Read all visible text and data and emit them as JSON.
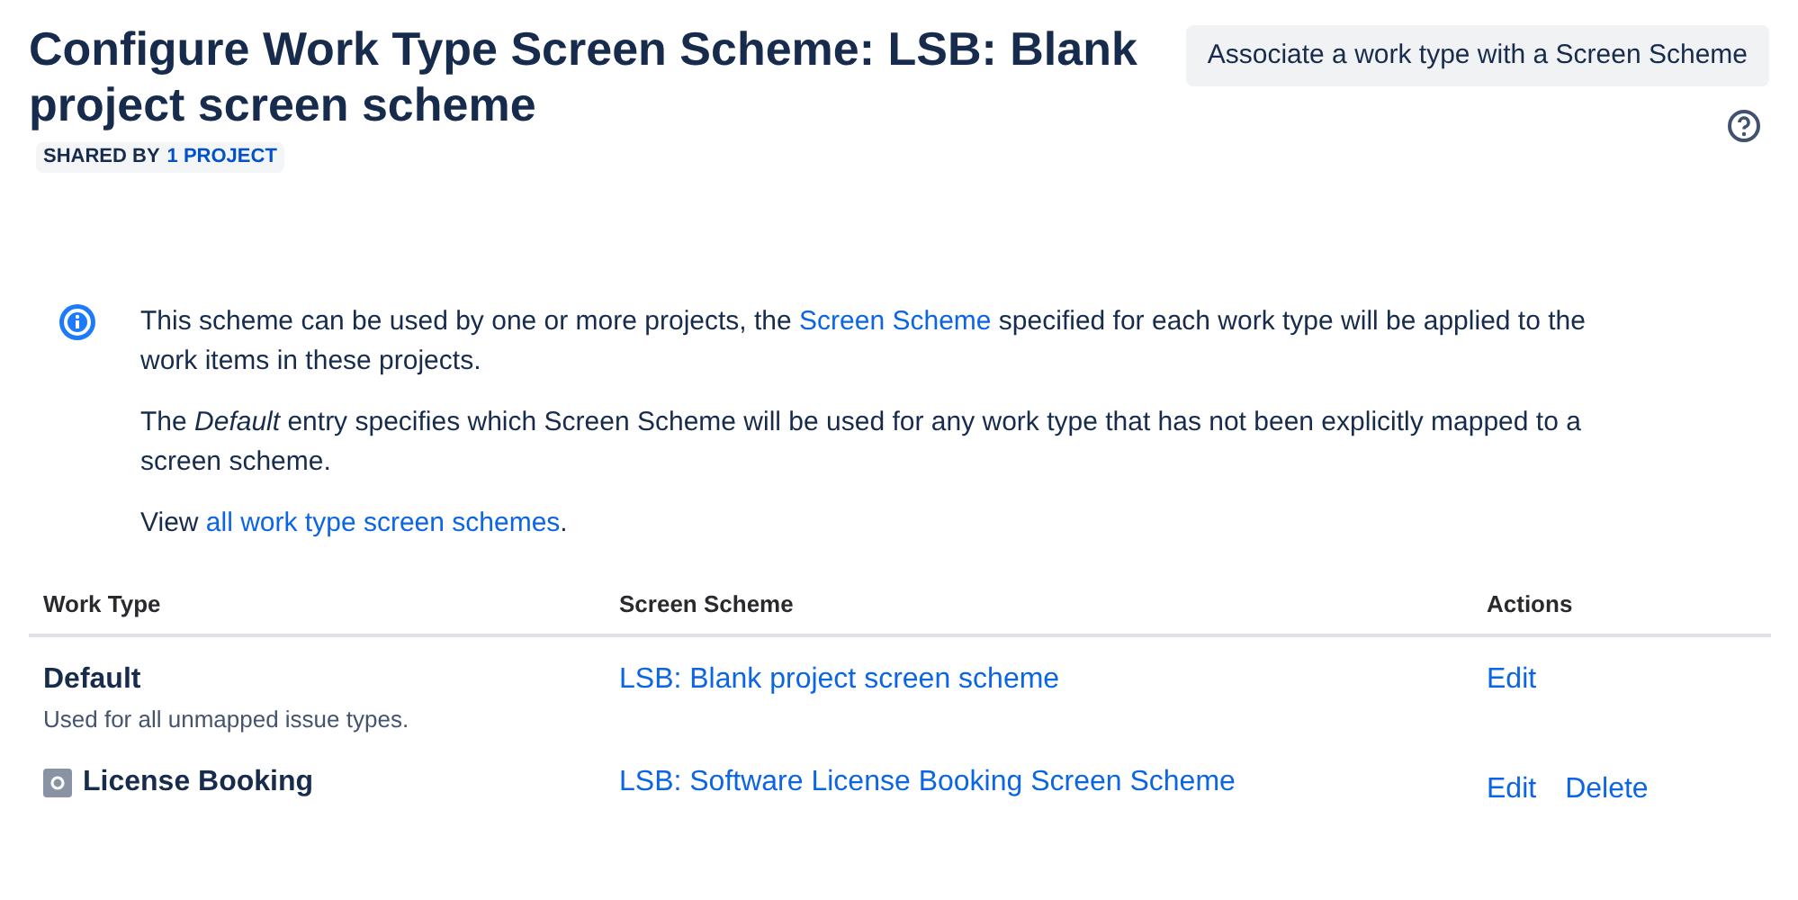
{
  "header": {
    "title": "Configure Work Type Screen Scheme: LSB: Blank project screen scheme",
    "shared_label": "SHARED BY",
    "shared_link": "1 PROJECT",
    "action_button": "Associate a work type with a Screen Scheme"
  },
  "info": {
    "paragraphs": [
      [
        {
          "text": "This scheme can be used by one or more projects, the "
        },
        {
          "text": "Screen Scheme",
          "link": true
        },
        {
          "text": " specified for each work type will be applied to the work items in these projects."
        }
      ],
      [
        {
          "text": "The *Default* entry specifies which Screen Scheme will be used for any work type that has not been explicitly mapped to a screen scheme."
        }
      ],
      [
        {
          "text": "View "
        },
        {
          "text": "all work type screen schemes",
          "link": true
        },
        {
          "text": "."
        }
      ]
    ]
  },
  "table": {
    "columns": [
      "Work Type",
      "Screen Scheme",
      "Actions"
    ],
    "rows": [
      {
        "name": "Default",
        "description": "Used for all unmapped issue types.",
        "icon": false,
        "scheme": "LSB: Blank project screen scheme",
        "actions": [
          "Edit"
        ]
      },
      {
        "name": "License Booking",
        "icon": true,
        "scheme": "LSB: Software License Booking Screen Scheme",
        "actions": [
          "Edit",
          "Delete"
        ]
      }
    ]
  }
}
